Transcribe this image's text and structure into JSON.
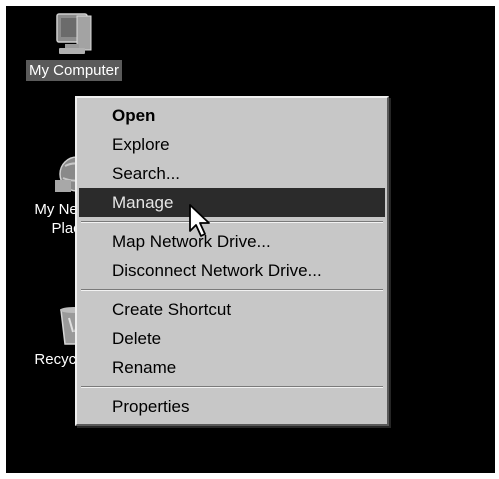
{
  "desktop": {
    "background": "#000000",
    "icons": [
      {
        "label": "My Computer",
        "icon": "my-computer-icon",
        "selected": true
      },
      {
        "label": "My Network Places",
        "icon": "network-places-icon",
        "selected": false
      },
      {
        "label": "Recycle Bin",
        "icon": "recycle-bin-icon",
        "selected": false
      }
    ]
  },
  "context_menu": {
    "items": [
      {
        "label": "Open",
        "bold": true
      },
      {
        "label": "Explore"
      },
      {
        "label": "Search..."
      },
      {
        "label": "Manage",
        "highlighted": true
      },
      {
        "label": "Map Network Drive..."
      },
      {
        "label": "Disconnect Network Drive..."
      },
      {
        "label": "Create Shortcut"
      },
      {
        "label": "Delete"
      },
      {
        "label": "Rename"
      },
      {
        "label": "Properties"
      }
    ]
  },
  "cursor": {
    "icon": "mouse-pointer-icon"
  }
}
